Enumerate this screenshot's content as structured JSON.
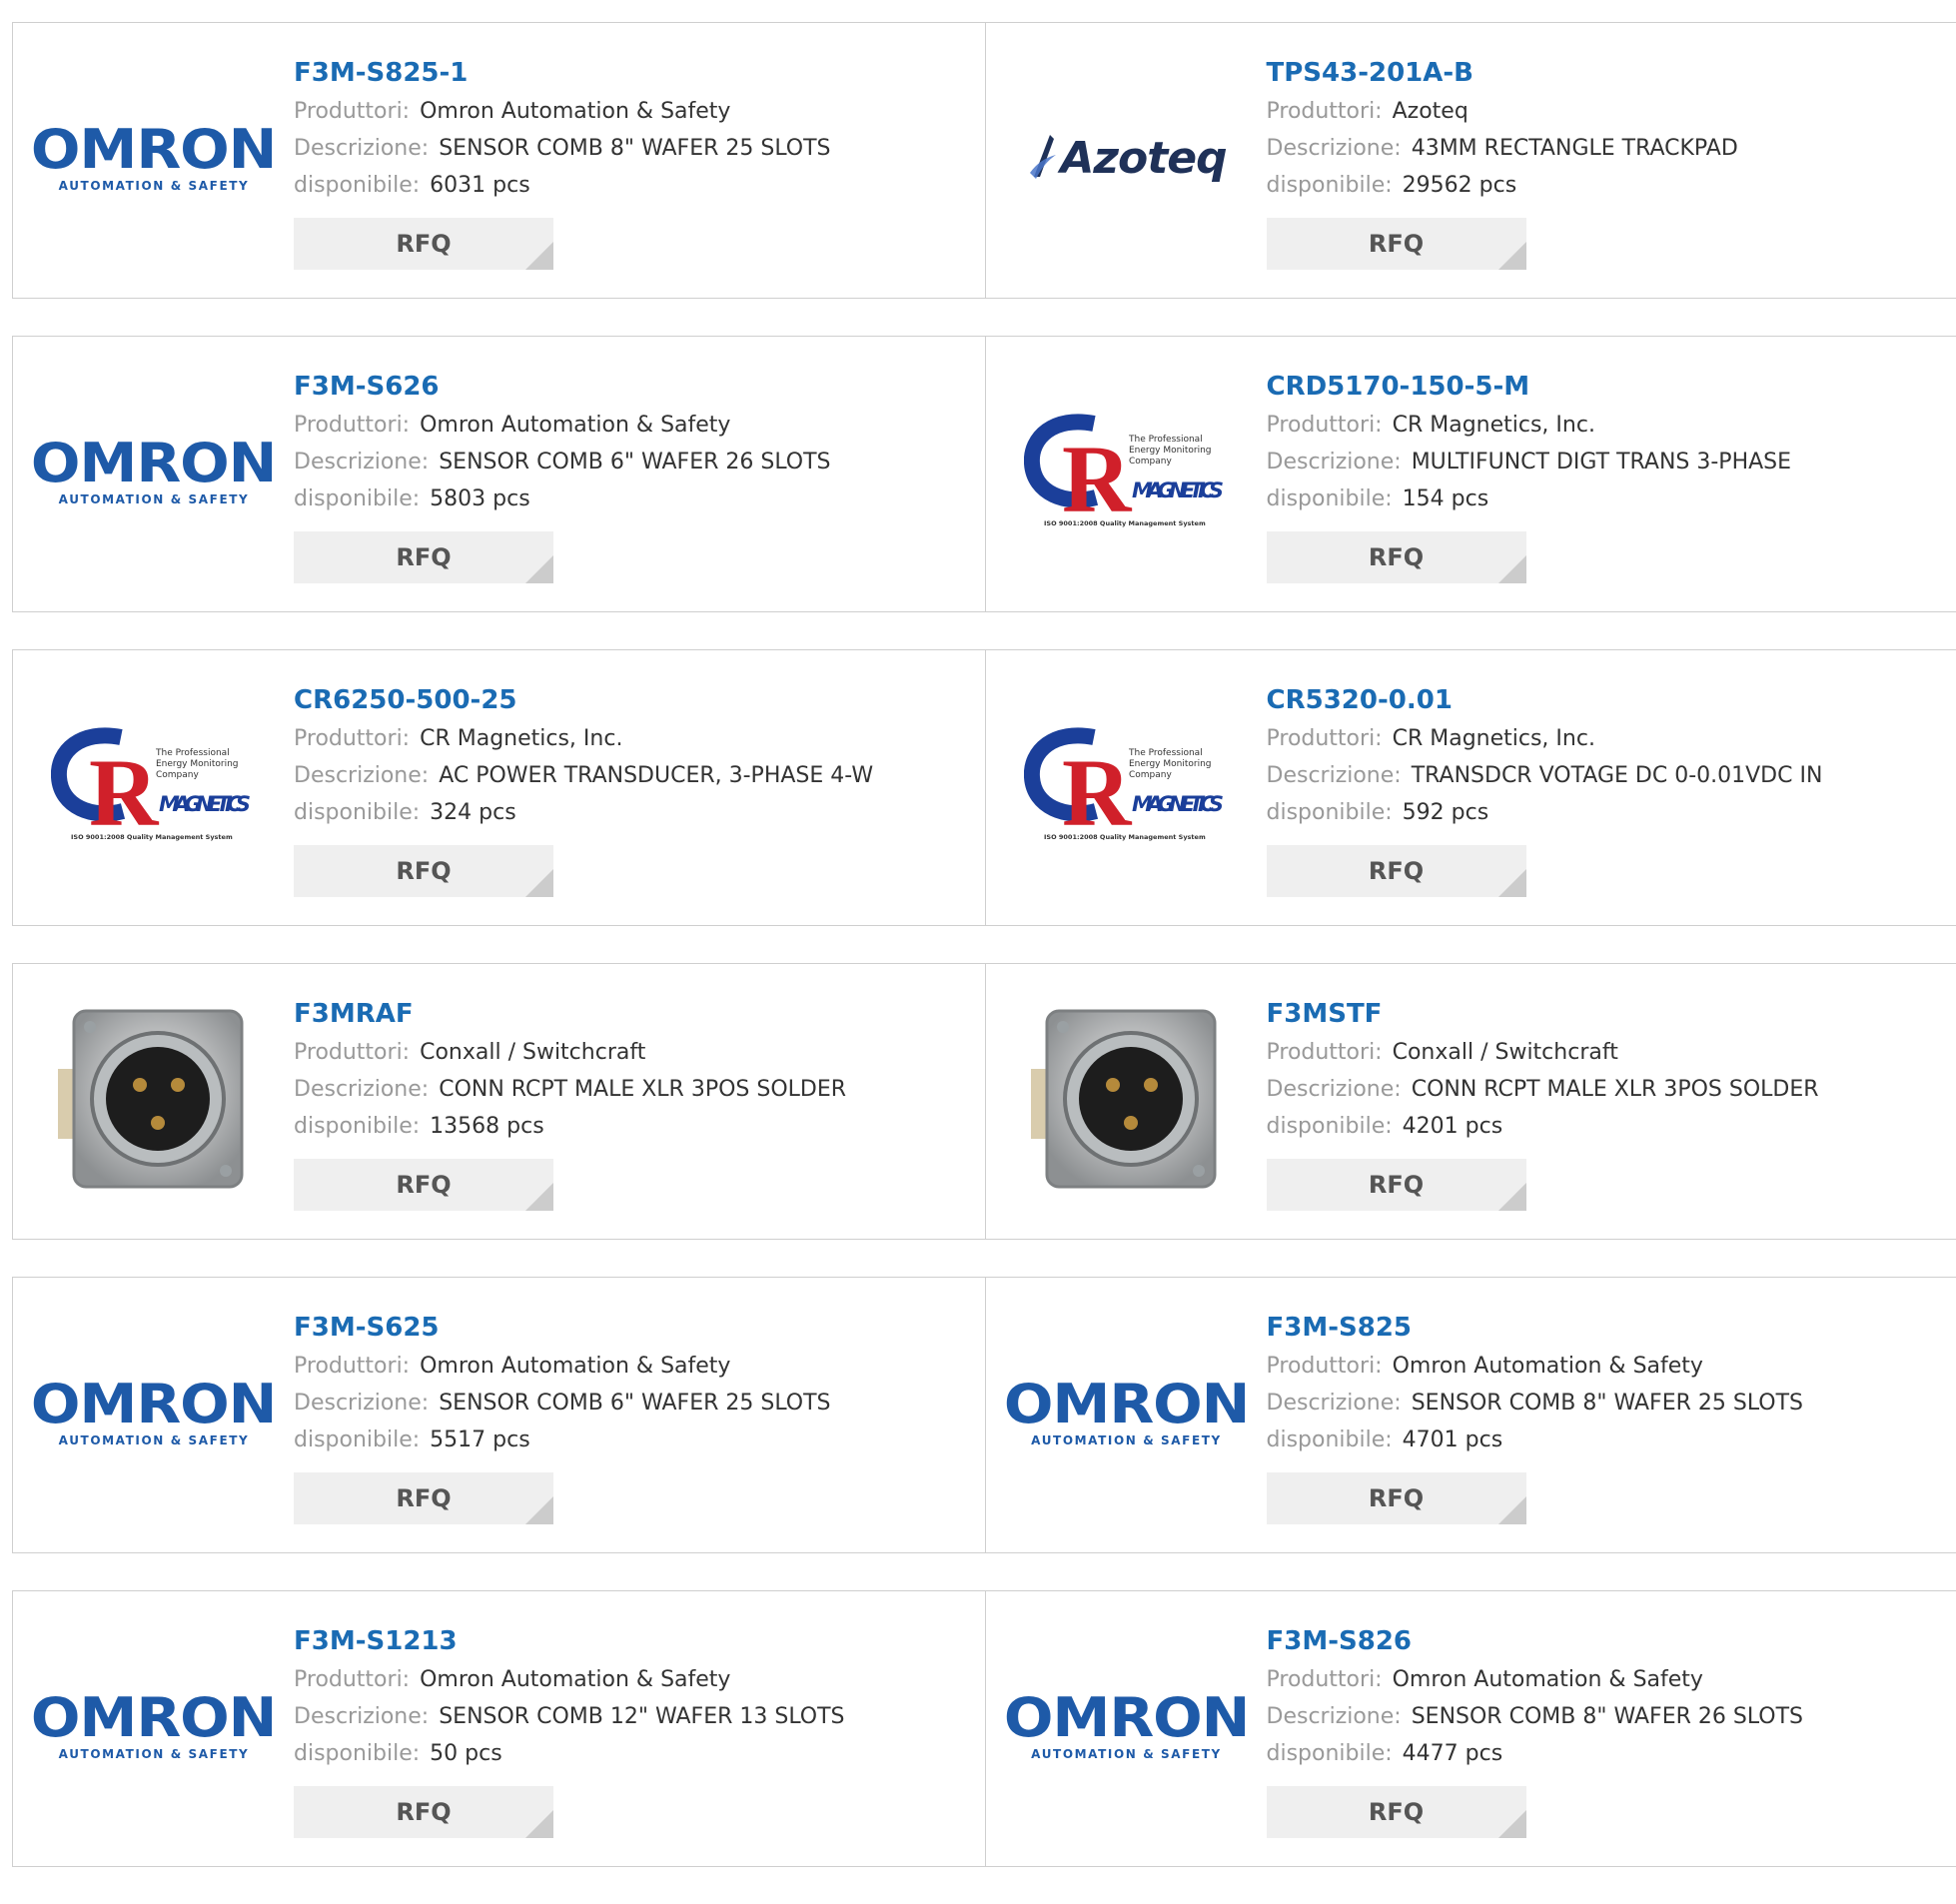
{
  "labels": {
    "manufacturer": "Produttori:",
    "description": "Descrizione:",
    "available": "disponibile:",
    "rfq": "RFQ"
  },
  "logo_text": {
    "omron_big": "OMRON",
    "omron_small": "AUTOMATION & SAFETY",
    "azoteq": "Azoteq",
    "cr_company": "The Professional Energy Monitoring Company",
    "cr_magnetics": "MAGNETICS",
    "cr_iso": "ISO 9001:2008 Quality Management System"
  },
  "colors": {
    "part_link": "#1a6bb3",
    "label": "#999999",
    "value": "#333333",
    "rfq_bg": "#efefef",
    "border": "#cfcfcf"
  },
  "products": [
    {
      "part": "F3M-S825-1",
      "manufacturer": "Omron Automation & Safety",
      "description": "SENSOR COMB 8\" WAFER 25 SLOTS",
      "available": "6031 pcs",
      "logo": "omron-logo"
    },
    {
      "part": "TPS43-201A-B",
      "manufacturer": "Azoteq",
      "description": "43MM RECTANGLE TRACKPAD",
      "available": "29562 pcs",
      "logo": "azoteq-logo"
    },
    {
      "part": "F3M-S626",
      "manufacturer": "Omron Automation & Safety",
      "description": "SENSOR COMB 6\" WAFER 26 SLOTS",
      "available": "5803 pcs",
      "logo": "omron-logo"
    },
    {
      "part": "CRD5170-150-5-M",
      "manufacturer": "CR Magnetics, Inc.",
      "description": "MULTIFUNCT DIGT TRANS 3-PHASE",
      "available": "154 pcs",
      "logo": "cr-magnetics-logo"
    },
    {
      "part": "CR6250-500-25",
      "manufacturer": "CR Magnetics, Inc.",
      "description": "AC POWER TRANSDUCER, 3-PHASE 4-W",
      "available": "324 pcs",
      "logo": "cr-magnetics-logo"
    },
    {
      "part": "CR5320-0.01",
      "manufacturer": "CR Magnetics, Inc.",
      "description": "TRANSDCR VOTAGE DC 0-0.01VDC IN",
      "available": "592 pcs",
      "logo": "cr-magnetics-logo"
    },
    {
      "part": "F3MRAF",
      "manufacturer": "Conxall / Switchcraft",
      "description": "CONN RCPT MALE XLR 3POS SOLDER",
      "available": "13568 pcs",
      "logo": "xlr-connector-image"
    },
    {
      "part": "F3MSTF",
      "manufacturer": "Conxall / Switchcraft",
      "description": "CONN RCPT MALE XLR 3POS SOLDER",
      "available": "4201 pcs",
      "logo": "xlr-connector-image"
    },
    {
      "part": "F3M-S625",
      "manufacturer": "Omron Automation & Safety",
      "description": "SENSOR COMB 6\" WAFER 25 SLOTS",
      "available": "5517 pcs",
      "logo": "omron-logo"
    },
    {
      "part": "F3M-S825",
      "manufacturer": "Omron Automation & Safety",
      "description": "SENSOR COMB 8\" WAFER 25 SLOTS",
      "available": "4701 pcs",
      "logo": "omron-logo"
    },
    {
      "part": "F3M-S1213",
      "manufacturer": "Omron Automation & Safety",
      "description": "SENSOR COMB 12\" WAFER 13 SLOTS",
      "available": "50 pcs",
      "logo": "omron-logo"
    },
    {
      "part": "F3M-S826",
      "manufacturer": "Omron Automation & Safety",
      "description": "SENSOR COMB 8\" WAFER 26 SLOTS",
      "available": "4477 pcs",
      "logo": "omron-logo"
    }
  ]
}
